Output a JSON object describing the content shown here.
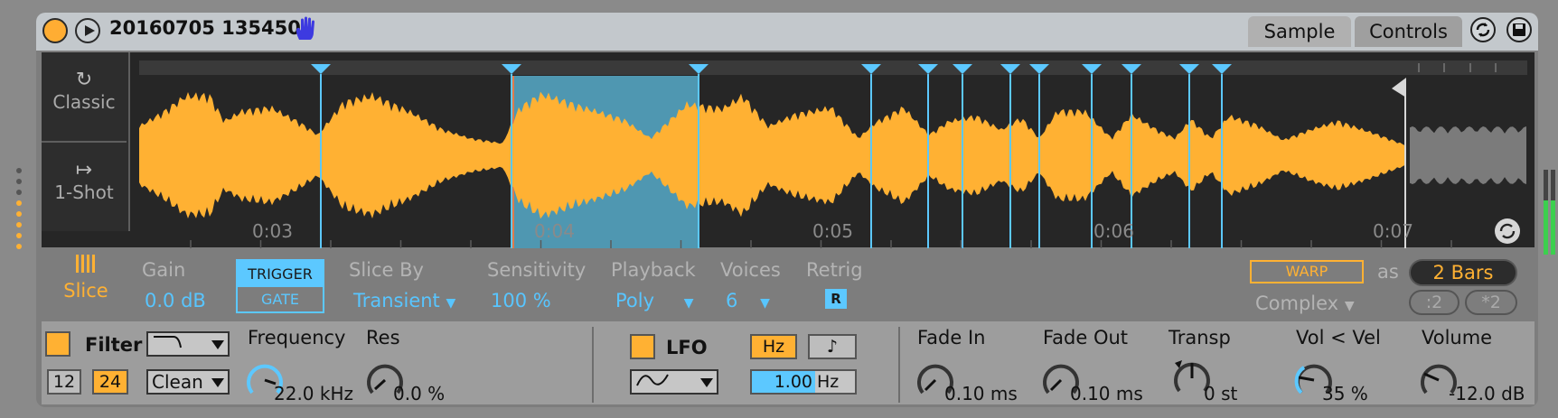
{
  "header": {
    "title": "20160705 135450",
    "tabs": [
      "Sample",
      "Controls"
    ]
  },
  "modes": {
    "classic": "Classic",
    "oneshot": "1-Shot",
    "slice": "Slice"
  },
  "waveform": {
    "time_labels": [
      "0:03",
      "0:04",
      "0:05",
      "0:06",
      "0:07"
    ],
    "selected_slice": 2,
    "slice_markers_px": null
  },
  "slice_params": {
    "gain_label": "Gain",
    "gain_value": "0.0 dB",
    "trigger_label": "TRIGGER",
    "gate_label": "GATE",
    "slice_by_label": "Slice By",
    "slice_by_value": "Transient",
    "sensitivity_label": "Sensitivity",
    "sensitivity_value": "100 %",
    "playback_label": "Playback",
    "playback_value": "Poly",
    "voices_label": "Voices",
    "voices_value": "6",
    "retrig_label": "Retrig",
    "retrig_value": "R"
  },
  "warp": {
    "warp_label": "WARP",
    "as_label": "as",
    "bars_value": "2 Bars",
    "mode_value": "Complex",
    "half_label": ":2",
    "double_label": "*2"
  },
  "filter": {
    "label": "Filter",
    "slope_12": "12",
    "slope_24": "24",
    "circuit_value": "Clean",
    "frequency_label": "Frequency",
    "frequency_value": "22.0 kHz",
    "res_label": "Res",
    "res_value": "0.0 %"
  },
  "lfo": {
    "label": "LFO",
    "hz_label": "Hz",
    "note_label": "♪",
    "rate_number": "1.00",
    "rate_unit": "Hz"
  },
  "envelope": {
    "fade_in_label": "Fade In",
    "fade_in_value": "0.10 ms",
    "fade_out_label": "Fade Out",
    "fade_out_value": "0.10 ms",
    "transp_label": "Transp",
    "transp_value": "0 st",
    "vol_vel_label": "Vol < Vel",
    "vol_vel_value": "35 %",
    "volume_label": "Volume",
    "volume_value": "-12.0 dB"
  },
  "colors": {
    "accent_orange": "#ffb133",
    "accent_blue": "#5cc8ff",
    "selection_blue": "#4f97b1",
    "waveform_grey": "#7b7b7b"
  }
}
